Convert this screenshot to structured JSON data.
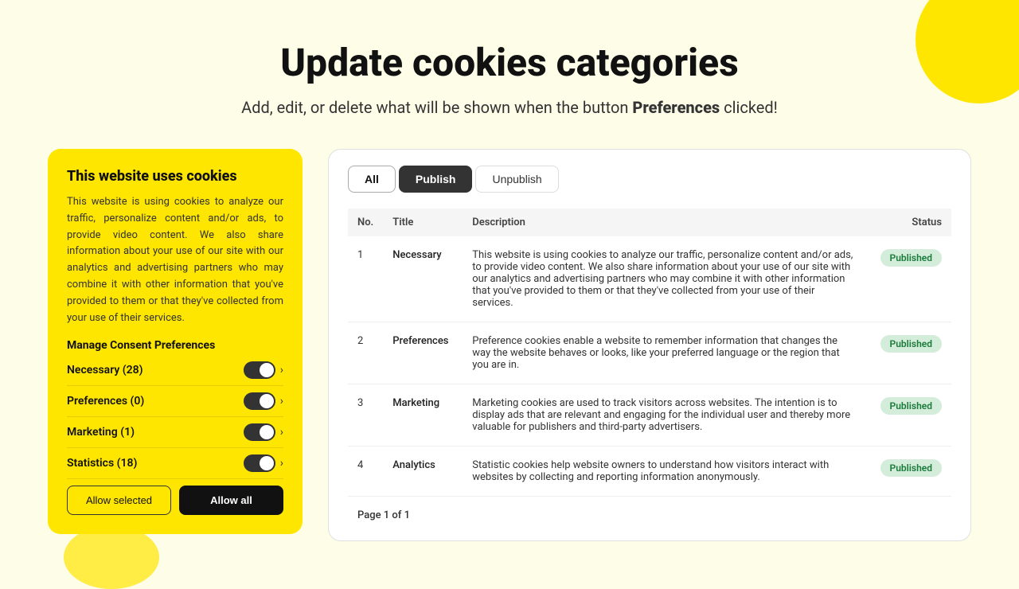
{
  "page": {
    "title": "Update cookies categories",
    "subtitle_before": "Add, edit, or delete what will be shown when the button ",
    "subtitle_bold": "Preferences",
    "subtitle_after": " clicked!"
  },
  "cookie_panel": {
    "title": "This website uses cookies",
    "description": "This website is using cookies to analyze our traffic, personalize content and/or ads, to provide video content. We also share information about your use of our site with our analytics and advertising partners who may combine it with other information that you've provided to them or that they've collected from your use of their services.",
    "manage_title": "Manage Consent Preferences",
    "items": [
      {
        "label": "Necessary (28)"
      },
      {
        "label": "Preferences (0)"
      },
      {
        "label": "Marketing (1)"
      },
      {
        "label": "Statistics (18)"
      }
    ],
    "btn_allow_selected": "Allow selected",
    "btn_allow_all": "Allow all"
  },
  "table_panel": {
    "tabs": [
      {
        "label": "All",
        "type": "all"
      },
      {
        "label": "Publish",
        "type": "publish"
      },
      {
        "label": "Unpublish",
        "type": "unpublish"
      }
    ],
    "columns": [
      {
        "key": "no",
        "label": "No."
      },
      {
        "key": "title",
        "label": "Title"
      },
      {
        "key": "description",
        "label": "Description"
      },
      {
        "key": "status",
        "label": "Status"
      }
    ],
    "rows": [
      {
        "no": "1",
        "title": "Necessary",
        "description": "This website is using cookies to analyze our traffic, personalize content and/or ads, to provide video content. We also share information about your use of our site with our analytics and advertising partners who may combine it with other information that you've provided to them or that they've collected from your use of their services.",
        "status": "Published"
      },
      {
        "no": "2",
        "title": "Preferences",
        "description": "Preference cookies enable a website to remember information that changes the way the website behaves or looks, like your preferred language or the region that you are in.",
        "status": "Published"
      },
      {
        "no": "3",
        "title": "Marketing",
        "description": "Marketing cookies are used to track visitors across websites. The intention is to display ads that are relevant and engaging for the individual user and thereby more valuable for publishers and third-party advertisers.",
        "status": "Published"
      },
      {
        "no": "4",
        "title": "Analytics",
        "description": "Statistic cookies help website owners to understand how visitors interact with websites by collecting and reporting information anonymously.",
        "status": "Published"
      }
    ],
    "pagination": "Page 1 of 1"
  }
}
